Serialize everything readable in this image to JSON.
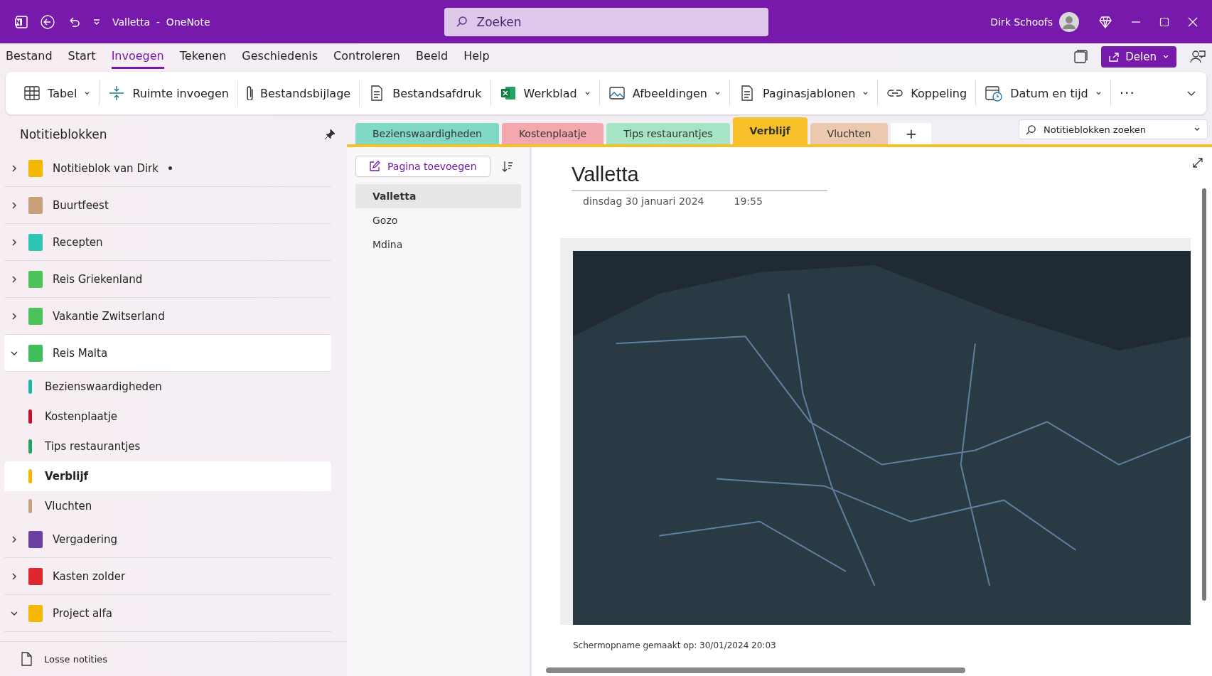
{
  "title_bar": {
    "app_title": "Valletta  -  OneNote",
    "search": {
      "placeholder": "Zoeken"
    },
    "user_name": "Dirk Schoofs"
  },
  "menu_tabs": [
    {
      "label": "Bestand",
      "selected": false
    },
    {
      "label": "Start",
      "selected": false
    },
    {
      "label": "Invoegen",
      "selected": true
    },
    {
      "label": "Tekenen",
      "selected": false
    },
    {
      "label": "Geschiedenis",
      "selected": false
    },
    {
      "label": "Controleren",
      "selected": false
    },
    {
      "label": "Beeld",
      "selected": false
    },
    {
      "label": "Help",
      "selected": false
    }
  ],
  "share_button": "Delen",
  "ribbon": [
    {
      "label": "Tabel",
      "kind": "table",
      "dropdown": true
    },
    {
      "label": "Ruimte invoegen",
      "kind": "spacing",
      "dropdown": false
    },
    {
      "label": "Bestandsbijlage",
      "kind": "attachment",
      "dropdown": false
    },
    {
      "label": "Bestandsafdruk",
      "kind": "printout",
      "dropdown": false
    },
    {
      "label": "Werkblad",
      "kind": "spreadsheet",
      "dropdown": true
    },
    {
      "label": "Afbeeldingen",
      "kind": "picture",
      "dropdown": true
    },
    {
      "label": "Paginasjablonen",
      "kind": "template",
      "dropdown": true
    },
    {
      "label": "Koppeling",
      "kind": "hyperlink",
      "dropdown": false
    },
    {
      "label": "Datum en tijd",
      "kind": "datetime",
      "dropdown": true
    }
  ],
  "ribbon_more": "···",
  "sidebar": {
    "title": "Notitieblokken",
    "notebooks": [
      {
        "name": "Notitieblok van Dirk",
        "color": "#f5b800",
        "expanded": false,
        "unsynced": true,
        "selected": false
      },
      {
        "name": "Buurtfeest",
        "color": "#c8a07a",
        "expanded": false,
        "unsynced": false,
        "selected": false
      },
      {
        "name": "Recepten",
        "color": "#2ec4b6",
        "expanded": false,
        "unsynced": false,
        "selected": false
      },
      {
        "name": "Reis Griekenland",
        "color": "#4cc25a",
        "expanded": false,
        "unsynced": false,
        "selected": false
      },
      {
        "name": "Vakantie Zwitserland",
        "color": "#4cc25a",
        "expanded": false,
        "unsynced": false,
        "selected": false
      },
      {
        "name": "Reis Malta",
        "color": "#3fbf5a",
        "expanded": true,
        "unsynced": false,
        "selected": true,
        "sections": [
          {
            "name": "Bezienswaardigheden",
            "color": "#1fb5a3",
            "selected": false
          },
          {
            "name": "Kostenplaatje",
            "color": "#c8102e",
            "selected": false
          },
          {
            "name": "Tips restaurantjes",
            "color": "#21a366",
            "selected": false
          },
          {
            "name": "Verblijf",
            "color": "#f5b800",
            "selected": true
          },
          {
            "name": "Vluchten",
            "color": "#c8a07a",
            "selected": false
          }
        ]
      },
      {
        "name": "Vergadering",
        "color": "#6b3fa0",
        "expanded": false,
        "unsynced": false,
        "selected": false
      },
      {
        "name": "Kasten zolder",
        "color": "#e0262f",
        "expanded": false,
        "unsynced": false,
        "selected": false
      },
      {
        "name": "Project alfa",
        "color": "#f5b800",
        "expanded": true,
        "unsynced": false,
        "selected": false
      }
    ],
    "loose_notes": "Losse notities"
  },
  "section_tabs": [
    {
      "label": "Bezienswaardigheden",
      "color": "#7fd9c4",
      "selected": false
    },
    {
      "label": "Kostenplaatje",
      "color": "#f3a8ad",
      "selected": false
    },
    {
      "label": "Tips restaurantjes",
      "color": "#a6e4c6",
      "selected": false
    },
    {
      "label": "Verblijf",
      "color": "#f8c12a",
      "selected": true
    },
    {
      "label": "Vluchten",
      "color": "#ecc9ae",
      "selected": false
    }
  ],
  "add_section": "+",
  "notebook_search": {
    "placeholder": "Notitieblokken zoeken"
  },
  "pages": {
    "add_page": "Pagina toevoegen",
    "items": [
      {
        "title": "Valletta",
        "selected": true
      },
      {
        "title": "Gozo",
        "selected": false
      },
      {
        "title": "Mdina",
        "selected": false
      }
    ]
  },
  "note": {
    "title": "Valletta",
    "date": "dinsdag 30 januari 2024",
    "time": "19:55",
    "caption": "Schermopname gemaakt op: 30/01/2024 20:03"
  }
}
